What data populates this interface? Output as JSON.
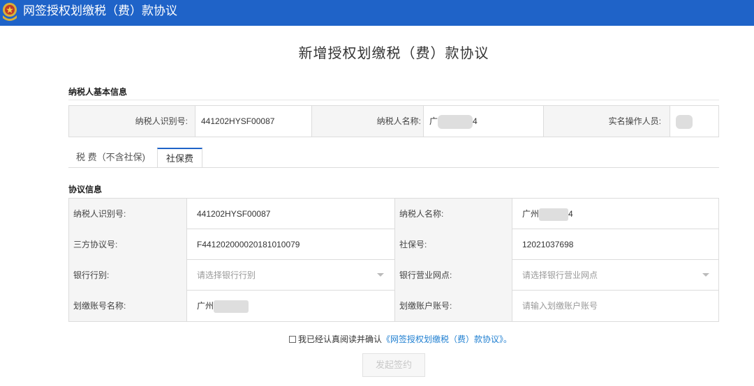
{
  "header": {
    "title": "网签授权划缴税（费）款协议"
  },
  "page": {
    "title": "新增授权划缴税（费）款协议"
  },
  "basic_info": {
    "section_title": "纳税人基本信息",
    "taxpayer_id_label": "纳税人识别号:",
    "taxpayer_id_value": "441202HYSF00087",
    "taxpayer_name_label": "纳税人名称:",
    "taxpayer_name_prefix": "广",
    "taxpayer_name_suffix": "4",
    "operator_label": "实名操作人员:"
  },
  "tabs": [
    {
      "label": "税 费（不含社保)",
      "active": false
    },
    {
      "label": "社保费",
      "active": true
    }
  ],
  "agreement": {
    "section_title": "协议信息",
    "rows": [
      {
        "left_label": "纳税人识别号:",
        "left_value": "441202HYSF00087",
        "right_label": "纳税人名称:",
        "right_value": "广州",
        "right_value_suffix": "4"
      },
      {
        "left_label": "三方协议号:",
        "left_value": "F441202000020181010079",
        "right_label": "社保号:",
        "right_value": "12021037698"
      },
      {
        "left_label": "银行行别:",
        "left_placeholder": "请选择银行行别",
        "right_label": "银行营业网点:",
        "right_placeholder": "请选择银行营业网点"
      },
      {
        "left_label": "划缴账号名称:",
        "left_value": "广州",
        "right_label": "划缴账户账号:",
        "right_placeholder": "请输入划缴账户账号"
      }
    ]
  },
  "confirm": {
    "text": "我已经认真阅读并确认",
    "link": "《网签授权划缴税（费）款协议》",
    "end": "。"
  },
  "submit": {
    "label": "发起签约"
  },
  "colors": {
    "header_bg": "#1f63c8",
    "link": "#1f7fd1"
  }
}
